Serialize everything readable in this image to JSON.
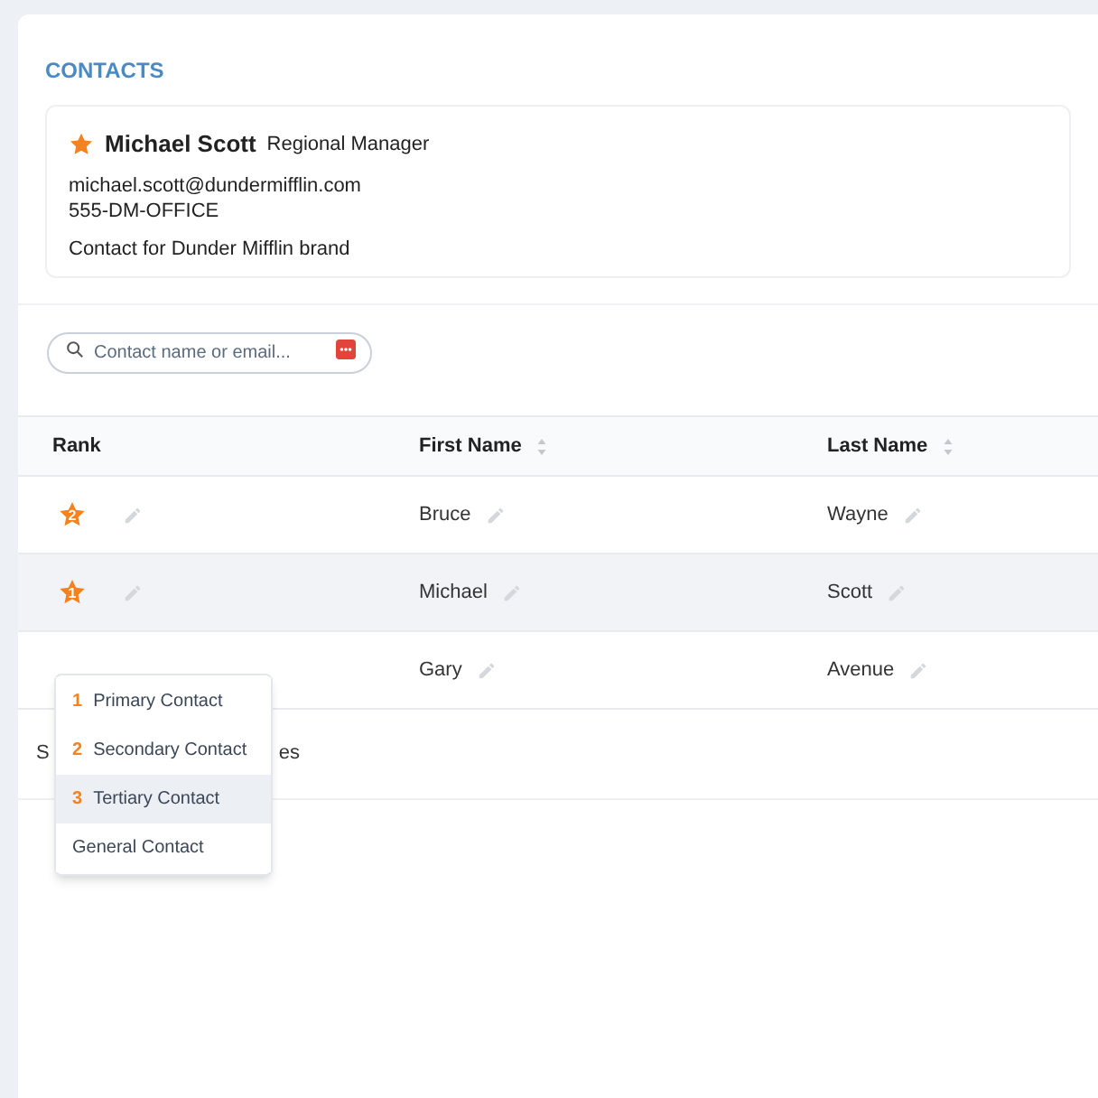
{
  "section_title": "CONTACTS",
  "primary_contact": {
    "starred": true,
    "name": "Michael Scott",
    "role": "Regional Manager",
    "email": "michael.scott@dundermifflin.com",
    "phone": "555-DM-OFFICE",
    "note": "Contact for Dunder Mifflin brand"
  },
  "search": {
    "placeholder": "Contact name or email..."
  },
  "table": {
    "columns": [
      {
        "label": "Rank",
        "sortable": false
      },
      {
        "label": "First Name",
        "sortable": true
      },
      {
        "label": "Last Name",
        "sortable": true
      }
    ],
    "rows": [
      {
        "rank": "2",
        "first_name": "Bruce",
        "last_name": "Wayne",
        "selected": false
      },
      {
        "rank": "1",
        "first_name": "Michael",
        "last_name": "Scott",
        "selected": true
      },
      {
        "first_name": "Gary",
        "last_name": "Avenue",
        "selected": false
      }
    ]
  },
  "footer_fragments": [
    "S",
    "es"
  ],
  "rank_menu": [
    {
      "number": "1",
      "label": "Primary Contact",
      "selected": false
    },
    {
      "number": "2",
      "label": "Secondary Contact",
      "selected": false
    },
    {
      "number": "3",
      "label": "Tertiary Contact",
      "selected": true
    },
    {
      "label": "General Contact",
      "selected": false
    }
  ]
}
